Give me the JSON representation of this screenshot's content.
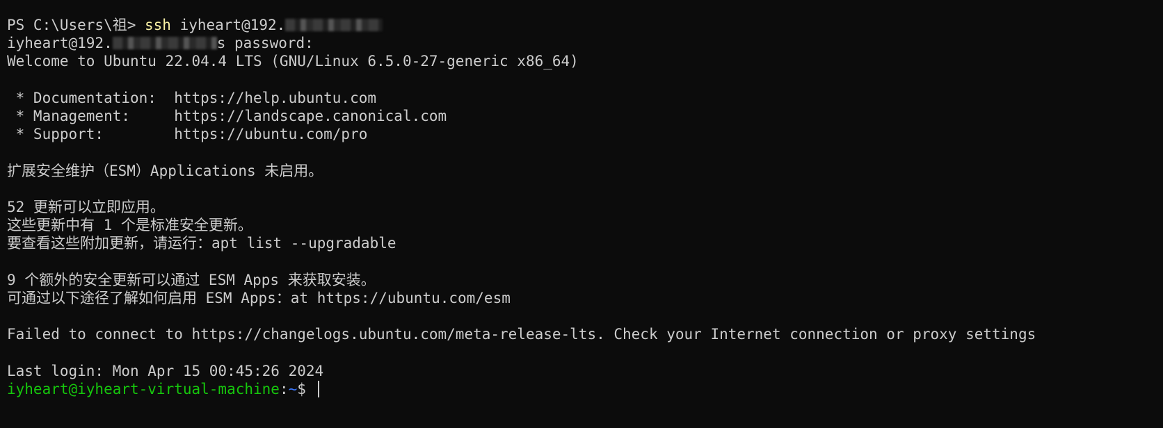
{
  "terminal": {
    "line1": {
      "prompt": "PS C:\\Users\\祖> ",
      "command": "ssh",
      "args": " iyheart@192."
    },
    "line2": {
      "prefix": "iyheart@192.",
      "suffix": "s password:"
    },
    "welcome": "Welcome to Ubuntu 22.04.4 LTS (GNU/Linux 6.5.0-27-generic x86_64)",
    "links": [
      " * Documentation:  https://help.ubuntu.com",
      " * Management:     https://landscape.canonical.com",
      " * Support:        https://ubuntu.com/pro"
    ],
    "esm_status": "扩展安全维护（ESM）Applications 未启用。",
    "updates": [
      "52 更新可以立即应用。",
      "这些更新中有 1 个是标准安全更新。",
      "要查看这些附加更新，请运行：apt list --upgradable"
    ],
    "esm_apps": [
      "9 个额外的安全更新可以通过 ESM Apps 来获取安装。",
      "可通过以下途径了解如何启用 ESM Apps：at https://ubuntu.com/esm"
    ],
    "failed": "Failed to connect to https://changelogs.ubuntu.com/meta-release-lts. Check your Internet connection or proxy settings",
    "last_login": "Last login: Mon Apr 15 00:45:26 2024",
    "prompt": {
      "user_host": "iyheart@iyheart-virtual-machine",
      "colon": ":",
      "path": "~",
      "symbol": "$ "
    }
  }
}
